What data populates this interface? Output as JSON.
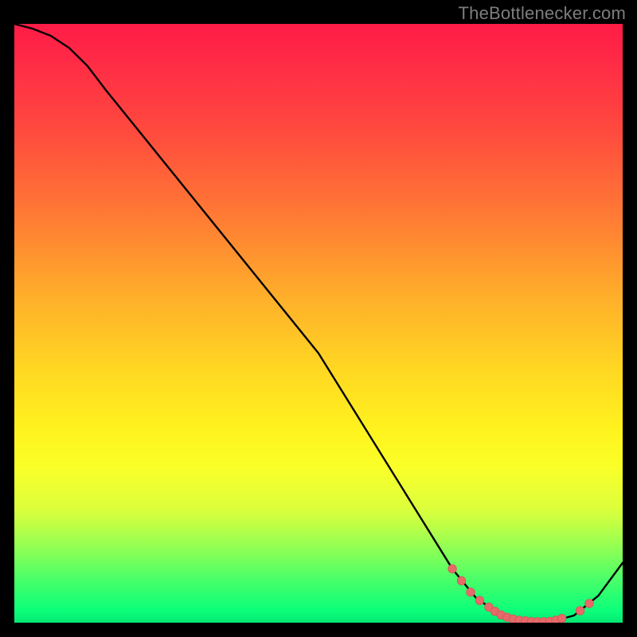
{
  "watermark": "TheBottlenecker.com",
  "colors": {
    "curve": "#000000",
    "dot_fill": "#e76a6a",
    "dot_stroke": "#d85a5a"
  },
  "chart_data": {
    "type": "line",
    "title": "",
    "xlabel": "",
    "ylabel": "",
    "xlim": [
      0,
      100
    ],
    "ylim": [
      0,
      100
    ],
    "series": [
      {
        "name": "curve",
        "x": [
          0,
          3,
          6,
          9,
          12,
          15,
          50,
          72,
          76,
          80,
          84,
          88,
          92,
          96,
          100
        ],
        "values": [
          100,
          99.2,
          98.0,
          96.0,
          93.0,
          89.0,
          45.0,
          9.0,
          4.0,
          1.4,
          0.2,
          0.1,
          1.2,
          4.5,
          10.0
        ]
      }
    ],
    "dots": [
      {
        "x": 72.0,
        "y": 9.0
      },
      {
        "x": 73.5,
        "y": 7.0
      },
      {
        "x": 75.0,
        "y": 5.1
      },
      {
        "x": 76.5,
        "y": 3.7
      },
      {
        "x": 78.0,
        "y": 2.6
      },
      {
        "x": 79.0,
        "y": 1.9
      },
      {
        "x": 80.0,
        "y": 1.3
      },
      {
        "x": 81.0,
        "y": 0.9
      },
      {
        "x": 82.0,
        "y": 0.6
      },
      {
        "x": 83.0,
        "y": 0.4
      },
      {
        "x": 84.0,
        "y": 0.3
      },
      {
        "x": 85.0,
        "y": 0.2
      },
      {
        "x": 86.0,
        "y": 0.15
      },
      {
        "x": 87.0,
        "y": 0.15
      },
      {
        "x": 88.0,
        "y": 0.2
      },
      {
        "x": 89.0,
        "y": 0.4
      },
      {
        "x": 90.0,
        "y": 0.7
      },
      {
        "x": 93.0,
        "y": 2.0
      },
      {
        "x": 94.5,
        "y": 3.2
      }
    ]
  }
}
